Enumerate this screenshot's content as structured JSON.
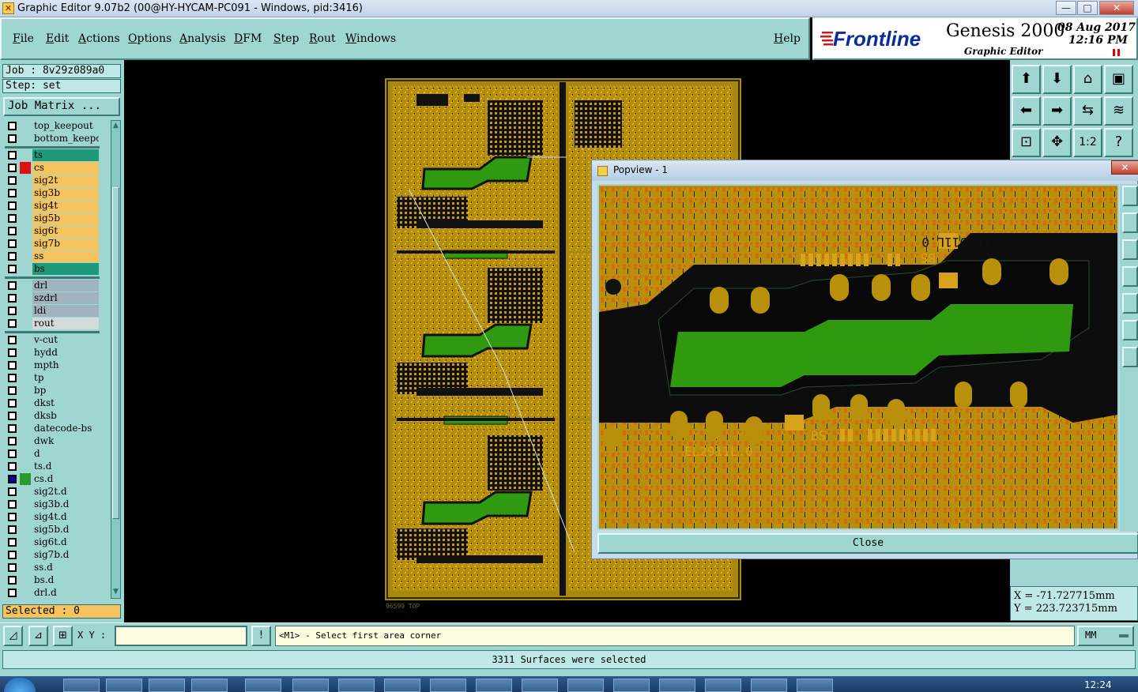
{
  "window": {
    "title": "Graphic Editor 9.07b2 (00@HY-HYCAM-PC091 - Windows, pid:3416)",
    "min_label": "—",
    "max_label": "□",
    "close_label": "✕"
  },
  "menubar": {
    "items": [
      "File",
      "Edit",
      "Actions",
      "Options",
      "Analysis",
      "DFM",
      "Step",
      "Rout",
      "Windows"
    ],
    "help": "Help"
  },
  "brand": {
    "logo_text": "Frontline",
    "product": "Genesis 2000",
    "subtitle": "Graphic Editor",
    "date": "08 Aug 2017",
    "time": "12:16 PM"
  },
  "left": {
    "job": "Job : 8v29z089a0",
    "step": "Step: set",
    "job_matrix": "Job Matrix ...",
    "selected": "Selected : 0"
  },
  "layers": [
    {
      "name": "top_keepout",
      "color": "#9fd6d2",
      "active": false,
      "mark": ""
    },
    {
      "name": "bottom_keepout",
      "color": "#9fd6d2",
      "active": false,
      "mark": ""
    },
    {
      "name": "ts",
      "color": "#1e9a7a",
      "active": false,
      "mark": ""
    },
    {
      "name": "cs",
      "color": "#f5c45f",
      "active": false,
      "mark": "#e01010"
    },
    {
      "name": "sig2t",
      "color": "#f5c45f",
      "active": false,
      "mark": ""
    },
    {
      "name": "sig3b",
      "color": "#f5c45f",
      "active": false,
      "mark": ""
    },
    {
      "name": "sig4t",
      "color": "#f5c45f",
      "active": false,
      "mark": ""
    },
    {
      "name": "sig5b",
      "color": "#f5c45f",
      "active": false,
      "mark": ""
    },
    {
      "name": "sig6t",
      "color": "#f5c45f",
      "active": false,
      "mark": ""
    },
    {
      "name": "sig7b",
      "color": "#f5c45f",
      "active": false,
      "mark": ""
    },
    {
      "name": "ss",
      "color": "#f5c45f",
      "active": false,
      "mark": ""
    },
    {
      "name": "bs",
      "color": "#1e9a7a",
      "active": false,
      "mark": ""
    },
    {
      "name": "drl",
      "color": "#9fb4bf",
      "active": false,
      "mark": ""
    },
    {
      "name": "szdrl",
      "color": "#9fb4bf",
      "active": false,
      "mark": ""
    },
    {
      "name": "ldi",
      "color": "#9fb4bf",
      "active": false,
      "mark": ""
    },
    {
      "name": "rout",
      "color": "#d3dcdc",
      "active": false,
      "mark": ""
    },
    {
      "name": "v-cut",
      "color": "#9fd6d2",
      "active": false,
      "mark": ""
    },
    {
      "name": "hydd",
      "color": "#9fd6d2",
      "active": false,
      "mark": ""
    },
    {
      "name": "mpth",
      "color": "#9fd6d2",
      "active": false,
      "mark": ""
    },
    {
      "name": "tp",
      "color": "#9fd6d2",
      "active": false,
      "mark": ""
    },
    {
      "name": "bp",
      "color": "#9fd6d2",
      "active": false,
      "mark": ""
    },
    {
      "name": "dkst",
      "color": "#9fd6d2",
      "active": false,
      "mark": ""
    },
    {
      "name": "dksb",
      "color": "#9fd6d2",
      "active": false,
      "mark": ""
    },
    {
      "name": "datecode-bs",
      "color": "#9fd6d2",
      "active": false,
      "mark": ""
    },
    {
      "name": "dwk",
      "color": "#9fd6d2",
      "active": false,
      "mark": ""
    },
    {
      "name": "d",
      "color": "#9fd6d2",
      "active": false,
      "mark": ""
    },
    {
      "name": "ts.d",
      "color": "#9fd6d2",
      "active": false,
      "mark": ""
    },
    {
      "name": "cs.d",
      "color": "#9fd6d2",
      "active": true,
      "mark": "#2a9a2a"
    },
    {
      "name": "sig2t.d",
      "color": "#9fd6d2",
      "active": false,
      "mark": ""
    },
    {
      "name": "sig3b.d",
      "color": "#9fd6d2",
      "active": false,
      "mark": ""
    },
    {
      "name": "sig4t.d",
      "color": "#9fd6d2",
      "active": false,
      "mark": ""
    },
    {
      "name": "sig5b.d",
      "color": "#9fd6d2",
      "active": false,
      "mark": ""
    },
    {
      "name": "sig6t.d",
      "color": "#9fd6d2",
      "active": false,
      "mark": ""
    },
    {
      "name": "sig7b.d",
      "color": "#9fd6d2",
      "active": false,
      "mark": ""
    },
    {
      "name": "ss.d",
      "color": "#9fd6d2",
      "active": false,
      "mark": ""
    },
    {
      "name": "bs.d",
      "color": "#9fd6d2",
      "active": false,
      "mark": ""
    },
    {
      "name": "drl.d",
      "color": "#9fd6d2",
      "active": false,
      "mark": ""
    }
  ],
  "canvas": {
    "board_label": "96599   TOP",
    "colors": {
      "board": "#b8960f",
      "mask": "#2f9a10",
      "trace": "#d8a21a",
      "pad": "#cc8a10"
    }
  },
  "popview": {
    "title": "Popview - 1",
    "marking_top": "EL2911L.0",
    "bs_top": "BS",
    "marking_bottom": "EL2911L.0",
    "bs_bottom": "BS",
    "close_label": "Close"
  },
  "right_tools": {
    "scale_label": "1:2",
    "help_label": "?"
  },
  "coords": {
    "x": "X = -71.727715mm",
    "y": "Y = 223.723715mm"
  },
  "command": {
    "xy_label": "X Y :",
    "xy_value": "",
    "prompt": "<M1> - Select first area corner",
    "units": "MM",
    "warn_label": "!"
  },
  "status": {
    "message": "3311 Surfaces were selected"
  },
  "taskbar": {
    "clock": "12:24"
  }
}
